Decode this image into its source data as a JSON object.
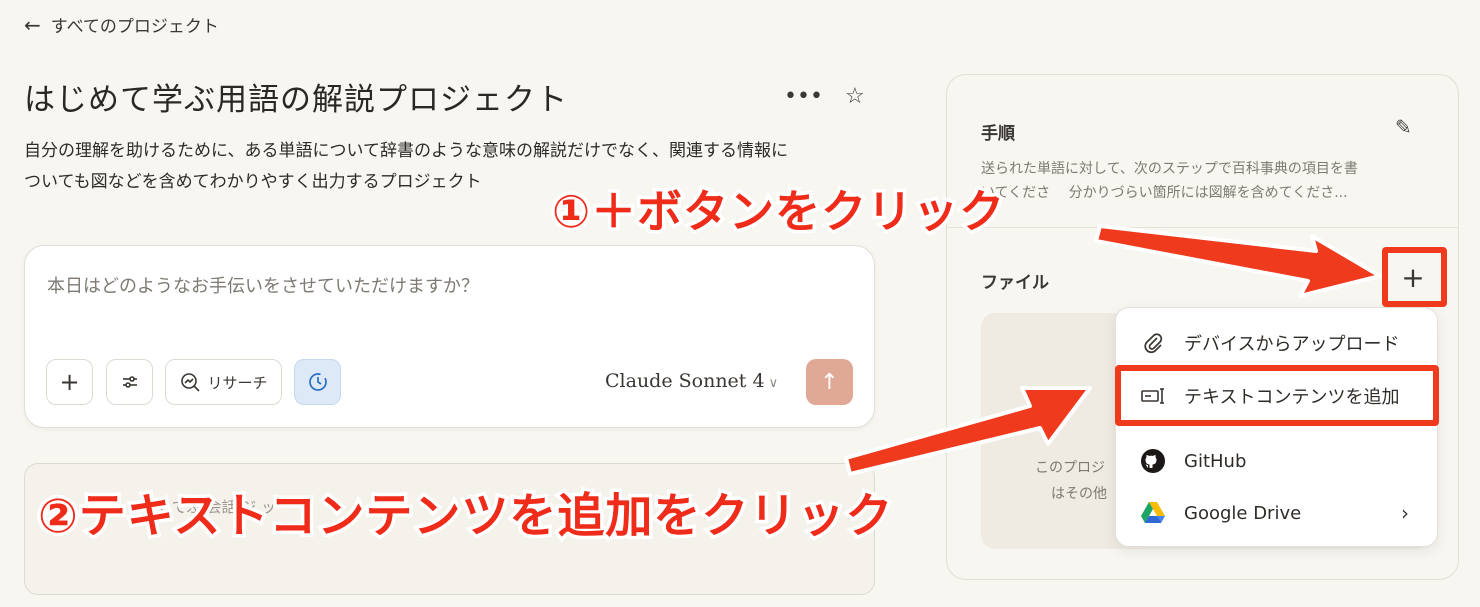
{
  "nav": {
    "back_label": "すべてのプロジェクト"
  },
  "project": {
    "title": "はじめて学ぶ用語の解説プロジェクト",
    "description_line1": "自分の理解を助けるために、ある単語について辞書のような意味の解説だけでなく、関連する情報に",
    "description_line2": "ついても図などを含めてわかりやすく出力するプロジェクト"
  },
  "chat": {
    "placeholder": "本日はどのようなお手伝いをさせていただけますか？",
    "research_label": "リサーチ",
    "model": "Claude Sonnet 4"
  },
  "second_box": {
    "text": "ャッ でぶ 会話  ジ  ッ "
  },
  "panel": {
    "steps_title": "手順",
    "steps_line1": "送られた単語に対して、次のステップで百科事典の項目を書",
    "steps_line2": "いてくださ　 分かりづらい箇所には図解を含めてくださ...",
    "files_title": "ファイル",
    "empty_line1": "このプロジ",
    "empty_line2": "はその他"
  },
  "dropdown": {
    "items": [
      {
        "label": "デバイスからアップロード",
        "icon": "paperclip-icon"
      },
      {
        "label": "テキストコンテンツを追加",
        "icon": "text-add-icon"
      },
      {
        "label": "GitHub",
        "icon": "github-icon"
      },
      {
        "label": "Google Drive",
        "icon": "google-drive-icon"
      }
    ]
  },
  "annotations": {
    "step1": "①＋ボタンをクリック",
    "step2": "②テキストコンテンツを追加をクリック"
  },
  "colors": {
    "accent_red": "#f03a1e",
    "send_button": "#e0a995",
    "background": "#f8f6f1"
  }
}
